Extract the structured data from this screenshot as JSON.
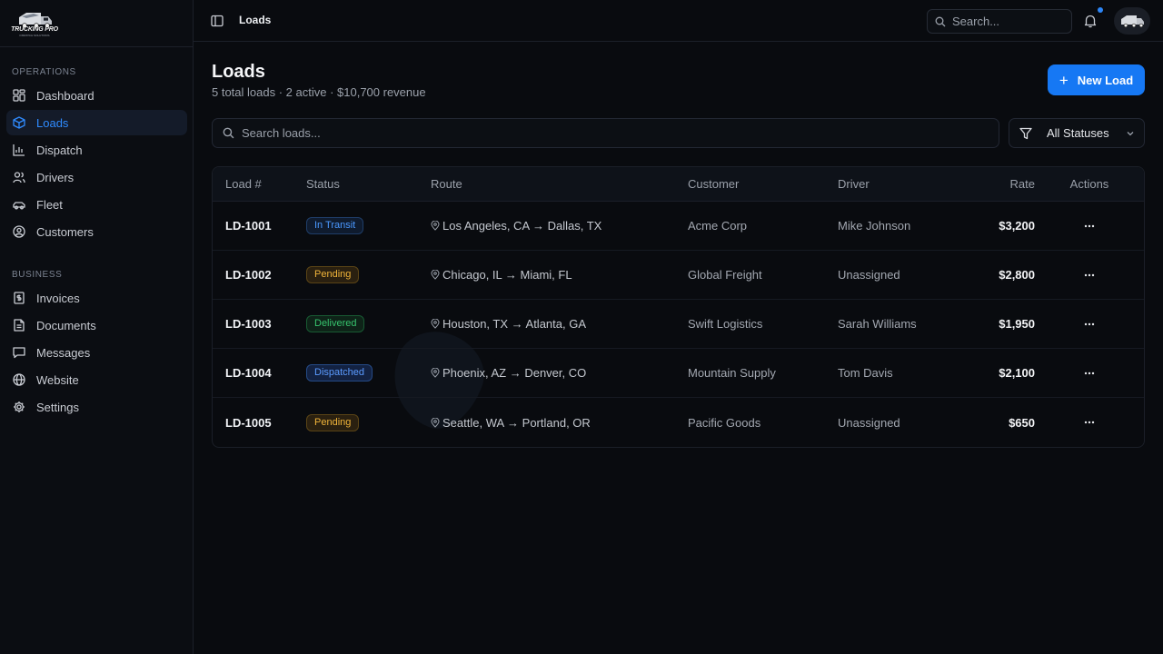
{
  "app": {
    "logo_text": "TRUCKING PRO",
    "logo_sub": "DISPATCH SOLUTIONS"
  },
  "sidebar": {
    "operations_label": "OPERATIONS",
    "operations_items": [
      {
        "label": "Dashboard",
        "icon": "dashboard-icon",
        "active": false
      },
      {
        "label": "Loads",
        "icon": "package-icon",
        "active": true
      },
      {
        "label": "Dispatch",
        "icon": "chart-icon",
        "active": false
      },
      {
        "label": "Drivers",
        "icon": "users-icon",
        "active": false
      },
      {
        "label": "Fleet",
        "icon": "car-icon",
        "active": false
      },
      {
        "label": "Customers",
        "icon": "user-circle-icon",
        "active": false
      }
    ],
    "business_label": "BUSINESS",
    "business_items": [
      {
        "label": "Invoices",
        "icon": "invoice-icon"
      },
      {
        "label": "Documents",
        "icon": "document-icon"
      },
      {
        "label": "Messages",
        "icon": "message-icon"
      },
      {
        "label": "Website",
        "icon": "globe-icon"
      },
      {
        "label": "Settings",
        "icon": "gear-icon"
      }
    ]
  },
  "topbar": {
    "breadcrumb": "Loads",
    "search_placeholder": "Search...",
    "has_notification": true
  },
  "main": {
    "title": "Loads",
    "subtitle": "5 total loads · 2 active · $10,700 revenue",
    "new_button": "New Load",
    "search_placeholder": "Search loads...",
    "status_filter": "All Statuses"
  },
  "table": {
    "headers": {
      "id": "Load #",
      "status": "Status",
      "route": "Route",
      "customer": "Customer",
      "driver": "Driver",
      "rate": "Rate",
      "actions": "Actions"
    },
    "rows": [
      {
        "id": "LD-1001",
        "status": "In Transit",
        "status_kind": "transit",
        "route": "Los Angeles, CA → Dallas, TX",
        "customer": "Acme Corp",
        "driver": "Mike Johnson",
        "rate": "$3,200"
      },
      {
        "id": "LD-1002",
        "status": "Pending",
        "status_kind": "pending",
        "route": "Chicago, IL → Miami, FL",
        "customer": "Global Freight",
        "driver": "Unassigned",
        "rate": "$2,800"
      },
      {
        "id": "LD-1003",
        "status": "Delivered",
        "status_kind": "delivered",
        "route": "Houston, TX → Atlanta, GA",
        "customer": "Swift Logistics",
        "driver": "Sarah Williams",
        "rate": "$1,950"
      },
      {
        "id": "LD-1004",
        "status": "Dispatched",
        "status_kind": "dispatched",
        "route": "Phoenix, AZ → Denver, CO",
        "customer": "Mountain Supply",
        "driver": "Tom Davis",
        "rate": "$2,100"
      },
      {
        "id": "LD-1005",
        "status": "Pending",
        "status_kind": "pending",
        "route": "Seattle, WA → Portland, OR",
        "customer": "Pacific Goods",
        "driver": "Unassigned",
        "rate": "$650"
      }
    ]
  },
  "colors": {
    "accent": "#1678f4",
    "background": "#090b0f",
    "transit": "#4a98ff",
    "pending": "#f0b43a",
    "delivered": "#37c46e",
    "dispatched": "#5b9bff"
  }
}
